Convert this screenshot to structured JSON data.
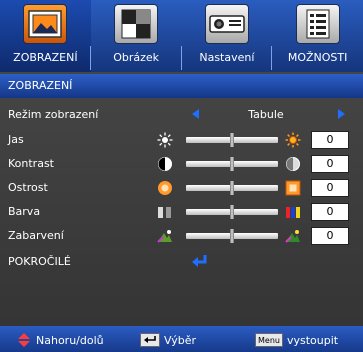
{
  "tabs": [
    {
      "label": "ZOBRAZENÍ",
      "icon": "picture-frame-icon",
      "active": true
    },
    {
      "label": "Obrázek",
      "icon": "grayscale-pattern-icon",
      "active": false
    },
    {
      "label": "Nastavení",
      "icon": "projector-icon",
      "active": false
    },
    {
      "label": "MOŽNOSTI",
      "icon": "document-list-icon",
      "active": false
    }
  ],
  "header": {
    "title": "ZOBRAZENÍ"
  },
  "mode": {
    "label": "Režim zobrazení",
    "value": "Tabule"
  },
  "sliders": [
    {
      "key": "brightness",
      "label": "Jas",
      "value": "0",
      "level": 0.5
    },
    {
      "key": "contrast",
      "label": "Kontrast",
      "value": "0",
      "level": 0.5
    },
    {
      "key": "sharpness",
      "label": "Ostrost",
      "value": "0",
      "level": 0.5
    },
    {
      "key": "color",
      "label": "Barva",
      "value": "0",
      "level": 0.5
    },
    {
      "key": "tint",
      "label": "Zabarvení",
      "value": "0",
      "level": 0.5
    }
  ],
  "advanced": {
    "label": "POKROČILÉ"
  },
  "footer": {
    "nav_label": "Nahoru/dolů",
    "select_label": "Výběr",
    "menu_key": "Menu",
    "exit_label": "vystoupit"
  },
  "colors": {
    "accent": "#1f6fff",
    "active_tab": "#f08a1e",
    "bar": "#2b5cc3"
  }
}
